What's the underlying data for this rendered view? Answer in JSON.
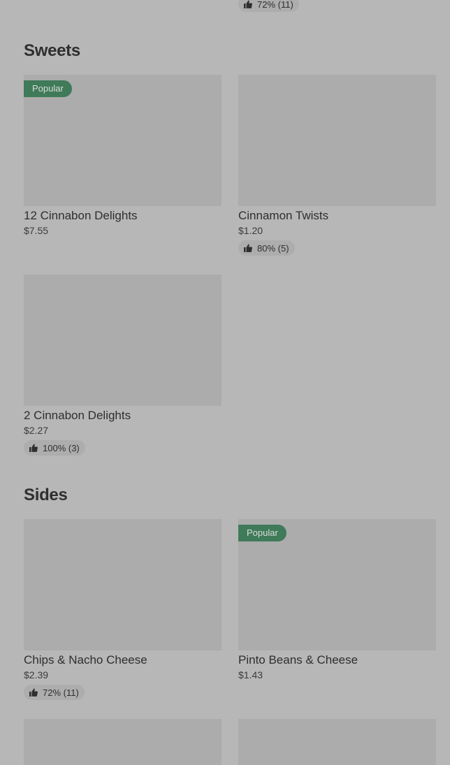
{
  "top_rating": "72% (11)",
  "sections": [
    {
      "title": "Sweets",
      "items": [
        {
          "name": "12 Cinnabon Delights",
          "price": "$7.55",
          "badge": "Popular",
          "rating": ""
        },
        {
          "name": "Cinnamon Twists",
          "price": "$1.20",
          "badge": "",
          "rating": "80% (5)"
        },
        {
          "name": "2 Cinnabon Delights",
          "price": "$2.27",
          "badge": "",
          "rating": "100% (3)"
        }
      ]
    },
    {
      "title": "Sides",
      "items": [
        {
          "name": "Chips & Nacho Cheese",
          "price": "$2.39",
          "badge": "",
          "rating": "72% (11)"
        },
        {
          "name": "Pinto Beans & Cheese",
          "price": "$1.43",
          "badge": "Popular",
          "rating": ""
        }
      ]
    }
  ],
  "colors": {
    "background": "#b7b7b7",
    "image_placeholder": "#acacac",
    "badge": "#3f7a59",
    "text": "#2e2e2e"
  },
  "icons": {
    "rating": "thumbs-up-icon"
  }
}
